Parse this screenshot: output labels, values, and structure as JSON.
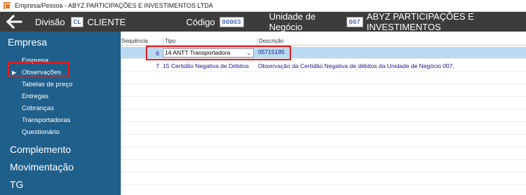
{
  "window": {
    "title": "Empresa/Pessoa - ABYZ PARTICIPAÇÕES E INVESTIMENTOS LTDA"
  },
  "header": {
    "divisao_label": "Divisão",
    "divisao_code": "CL",
    "divisao_value": "CLIENTE",
    "codigo_label": "Código",
    "codigo_value": "00003",
    "unidade_label": "Unidade de Negócio",
    "unidade_code": "007",
    "unidade_value": "ABYZ PARTICIPAÇÕES E INVESTIMENTOS"
  },
  "sidebar": {
    "section": "Empresa",
    "items": [
      {
        "label": "Empresa"
      },
      {
        "label": "Observações"
      },
      {
        "label": "Tabelas de preço"
      },
      {
        "label": "Entregas"
      },
      {
        "label": "Cobranças"
      },
      {
        "label": "Transportadoras"
      },
      {
        "label": "Questionário"
      }
    ],
    "groups": [
      {
        "label": "Complemento"
      },
      {
        "label": "Movimentação"
      },
      {
        "label": "TG"
      }
    ]
  },
  "grid": {
    "columns": {
      "seq": "Sequência",
      "tipo": "Tipo",
      "descricao": "Descrição"
    },
    "rows": [
      {
        "seq": "6",
        "tipo": "14 ANTT Transportadora",
        "descricao": "05715195"
      },
      {
        "seq": "7",
        "tipo": "15 Certidão Negativa de Débitos",
        "descricao": "Observação da Certidão Negativa de débitos da Unidade de Negócio 007."
      }
    ]
  },
  "colors": {
    "sidebar": "#1f5f8b",
    "header": "#3c3c3c",
    "selected_row": "#b9daf1",
    "highlight": "#e01e1e"
  }
}
